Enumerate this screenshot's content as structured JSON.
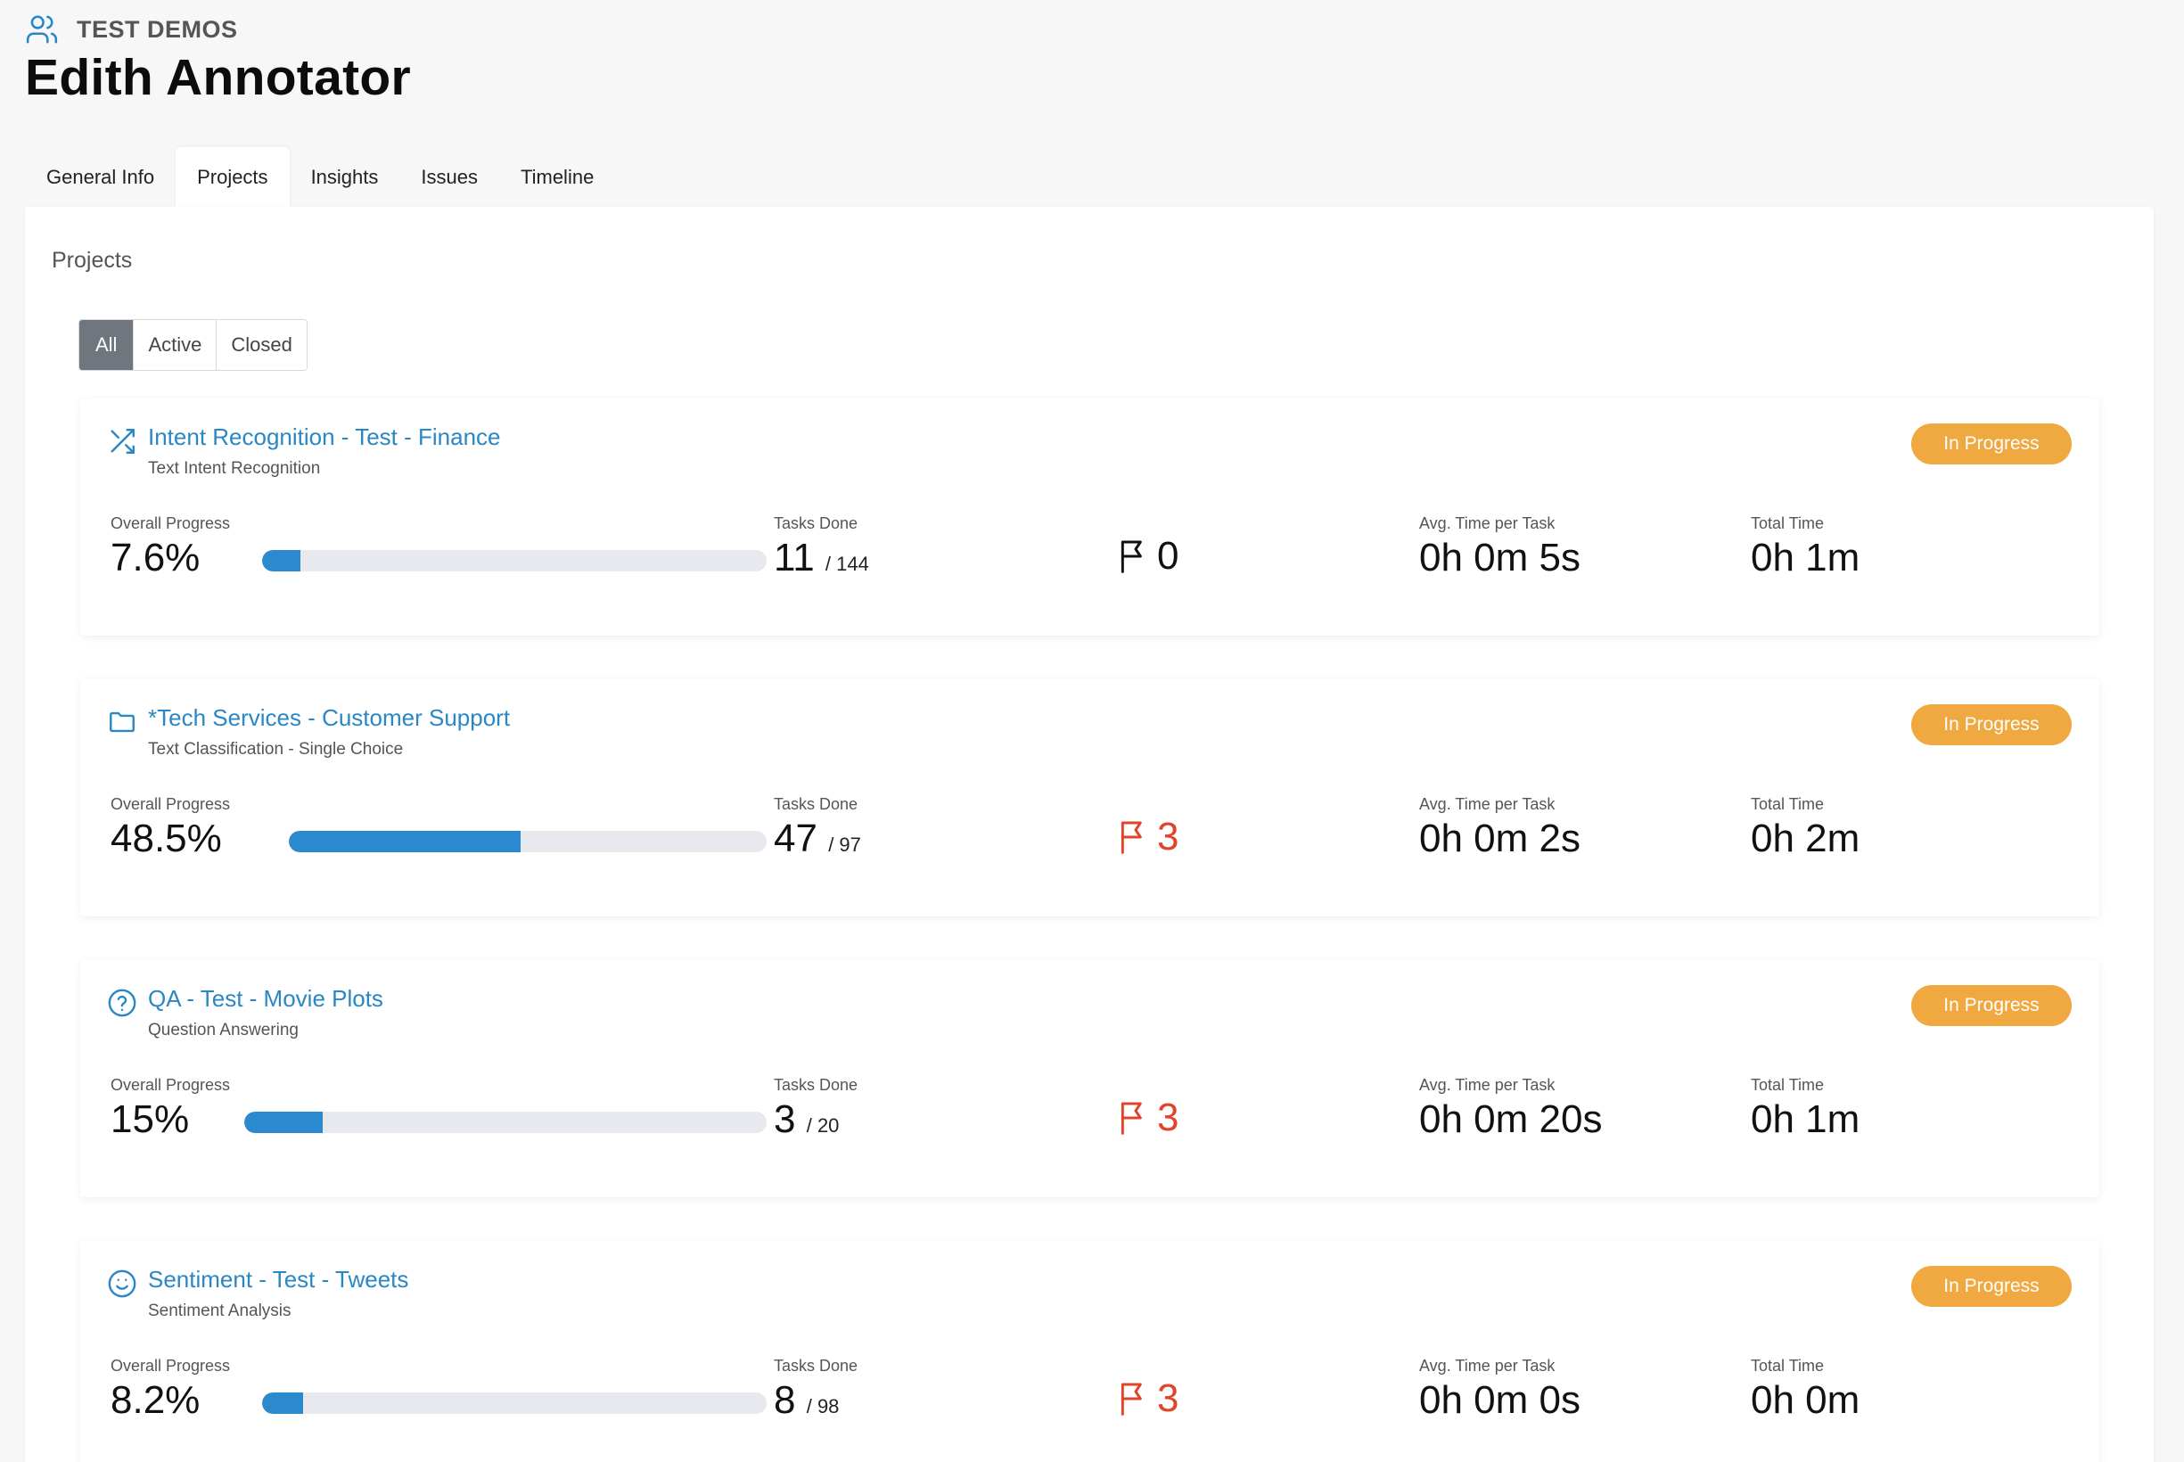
{
  "header": {
    "org_name": "TEST DEMOS",
    "user_name": "Edith Annotator"
  },
  "tabs": [
    {
      "label": "General Info",
      "active": false
    },
    {
      "label": "Projects",
      "active": true
    },
    {
      "label": "Insights",
      "active": false
    },
    {
      "label": "Issues",
      "active": false
    },
    {
      "label": "Timeline",
      "active": false
    }
  ],
  "panel": {
    "title": "Projects"
  },
  "filters": [
    {
      "label": "All",
      "active": true
    },
    {
      "label": "Active",
      "active": false
    },
    {
      "label": "Closed",
      "active": false
    }
  ],
  "colors": {
    "accent": "#2a87c5",
    "progress_fill": "#2a8acd",
    "badge": "#f0a841",
    "flag_zero": "#111111",
    "flag_active": "#e0452c"
  },
  "labels": {
    "overall_progress": "Overall Progress",
    "tasks_done": "Tasks Done",
    "avg_time": "Avg. Time per Task",
    "total_time": "Total Time"
  },
  "projects": [
    {
      "icon": "shuffle-icon",
      "title": "Intent Recognition - Test - Finance",
      "subtitle": "Text Intent Recognition",
      "status": "In Progress",
      "progress_text": "7.6%",
      "progress_value": 7.6,
      "tasks_done": "11",
      "tasks_total": "/ 144",
      "flags": "0",
      "avg_time": "0h 0m 5s",
      "total_time": "0h 1m"
    },
    {
      "icon": "folder-icon",
      "title": "*Tech Services - Customer Support",
      "subtitle": "Text Classification - Single Choice",
      "status": "In Progress",
      "progress_text": "48.5%",
      "progress_value": 48.5,
      "tasks_done": "47",
      "tasks_total": "/ 97",
      "flags": "3",
      "avg_time": "0h 0m 2s",
      "total_time": "0h 2m"
    },
    {
      "icon": "question-circle-icon",
      "title": "QA - Test - Movie Plots",
      "subtitle": "Question Answering",
      "status": "In Progress",
      "progress_text": "15%",
      "progress_value": 15,
      "tasks_done": "3",
      "tasks_total": "/ 20",
      "flags": "3",
      "avg_time": "0h 0m 20s",
      "total_time": "0h 1m"
    },
    {
      "icon": "smile-icon",
      "title": "Sentiment - Test - Tweets",
      "subtitle": "Sentiment Analysis",
      "status": "In Progress",
      "progress_text": "8.2%",
      "progress_value": 8.2,
      "tasks_done": "8",
      "tasks_total": "/ 98",
      "flags": "3",
      "avg_time": "0h 0m 0s",
      "total_time": "0h 0m"
    }
  ]
}
